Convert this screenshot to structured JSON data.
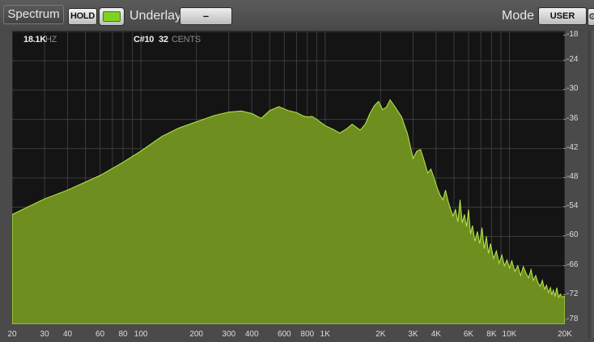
{
  "toolbar": {
    "title": "Spectrum",
    "hold_label": "HOLD",
    "underlay_label": "Underlay",
    "underlay_value": "–",
    "mode_label": "Mode",
    "mode_value": "USER"
  },
  "readout": {
    "freq": "18.1K",
    "freq_unit": "HZ",
    "note": "C#10",
    "cents": "32",
    "cents_unit": "CENTS"
  },
  "colors": {
    "fill": "#6e8f1f",
    "stroke": "#b8e84a",
    "background": "#141414",
    "swatch": "#7ed321"
  },
  "chart_data": {
    "type": "area",
    "x_scale": "log",
    "xlim": [
      20,
      20000
    ],
    "ylim": [
      -78,
      -18
    ],
    "y_ticks": [
      "-18",
      "-24",
      "-30",
      "-36",
      "-42",
      "-48",
      "-54",
      "-60",
      "-66",
      "-72",
      "-78"
    ],
    "x_ticks": [
      {
        "v": 20,
        "label": "20"
      },
      {
        "v": 30,
        "label": "30"
      },
      {
        "v": 40,
        "label": "40"
      },
      {
        "v": 60,
        "label": "60"
      },
      {
        "v": 80,
        "label": "80"
      },
      {
        "v": 100,
        "label": "100"
      },
      {
        "v": 200,
        "label": "200"
      },
      {
        "v": 300,
        "label": "300"
      },
      {
        "v": 400,
        "label": "400"
      },
      {
        "v": 600,
        "label": "600"
      },
      {
        "v": 800,
        "label": "800"
      },
      {
        "v": 1000,
        "label": "1K"
      },
      {
        "v": 2000,
        "label": "2K"
      },
      {
        "v": 3000,
        "label": "3K"
      },
      {
        "v": 4000,
        "label": "4K"
      },
      {
        "v": 6000,
        "label": "6K"
      },
      {
        "v": 8000,
        "label": "8K"
      },
      {
        "v": 10000,
        "label": "10K"
      },
      {
        "v": 20000,
        "label": "20K"
      }
    ],
    "grid_x": [
      20,
      30,
      40,
      50,
      60,
      70,
      80,
      90,
      100,
      200,
      300,
      400,
      500,
      600,
      700,
      800,
      900,
      1000,
      2000,
      3000,
      4000,
      5000,
      6000,
      7000,
      8000,
      9000,
      10000,
      20000
    ],
    "points": [
      [
        20,
        -55.5
      ],
      [
        30,
        -52.3
      ],
      [
        40,
        -50.5
      ],
      [
        60,
        -47.5
      ],
      [
        80,
        -44.8
      ],
      [
        100,
        -42.5
      ],
      [
        130,
        -39.5
      ],
      [
        160,
        -37.8
      ],
      [
        200,
        -36.5
      ],
      [
        250,
        -35.2
      ],
      [
        300,
        -34.5
      ],
      [
        350,
        -34.3
      ],
      [
        400,
        -34.8
      ],
      [
        450,
        -35.8
      ],
      [
        500,
        -34.2
      ],
      [
        560,
        -33.4
      ],
      [
        630,
        -34.2
      ],
      [
        700,
        -34.6
      ],
      [
        760,
        -35.3
      ],
      [
        800,
        -35.5
      ],
      [
        850,
        -35.4
      ],
      [
        900,
        -36.0
      ],
      [
        1000,
        -37.3
      ],
      [
        1100,
        -38.0
      ],
      [
        1200,
        -38.8
      ],
      [
        1300,
        -38.0
      ],
      [
        1400,
        -37.0
      ],
      [
        1550,
        -38.2
      ],
      [
        1650,
        -37.0
      ],
      [
        1750,
        -34.8
      ],
      [
        1850,
        -33.2
      ],
      [
        1950,
        -32.3
      ],
      [
        2050,
        -34.0
      ],
      [
        2150,
        -33.5
      ],
      [
        2250,
        -32.0
      ],
      [
        2400,
        -33.5
      ],
      [
        2600,
        -35.5
      ],
      [
        2800,
        -39.0
      ],
      [
        3000,
        -44.0
      ],
      [
        3150,
        -42.5
      ],
      [
        3300,
        -42.2
      ],
      [
        3450,
        -44.5
      ],
      [
        3600,
        -47.0
      ],
      [
        3750,
        -46.2
      ],
      [
        3900,
        -48.0
      ],
      [
        4050,
        -50.0
      ],
      [
        4200,
        -51.5
      ],
      [
        4350,
        -52.5
      ],
      [
        4500,
        -50.5
      ],
      [
        4650,
        -52.8
      ],
      [
        4800,
        -54.5
      ],
      [
        4950,
        -55.8
      ],
      [
        5100,
        -54.5
      ],
      [
        5250,
        -57.0
      ],
      [
        5400,
        -52.5
      ],
      [
        5550,
        -57.2
      ],
      [
        5700,
        -55.5
      ],
      [
        5850,
        -58.0
      ],
      [
        6000,
        -54.5
      ],
      [
        6150,
        -59.5
      ],
      [
        6300,
        -57.8
      ],
      [
        6500,
        -61.0
      ],
      [
        6700,
        -59.0
      ],
      [
        6900,
        -61.5
      ],
      [
        7100,
        -58.2
      ],
      [
        7300,
        -62.5
      ],
      [
        7500,
        -60.0
      ],
      [
        7700,
        -63.5
      ],
      [
        7900,
        -61.5
      ],
      [
        8200,
        -64.5
      ],
      [
        8500,
        -63.0
      ],
      [
        8800,
        -65.5
      ],
      [
        9100,
        -63.8
      ],
      [
        9400,
        -66.0
      ],
      [
        9700,
        -64.8
      ],
      [
        10000,
        -66.5
      ],
      [
        10300,
        -65.0
      ],
      [
        10700,
        -67.2
      ],
      [
        11100,
        -66.0
      ],
      [
        11500,
        -68.0
      ],
      [
        11900,
        -66.2
      ],
      [
        12300,
        -67.5
      ],
      [
        12700,
        -68.5
      ],
      [
        13100,
        -66.8
      ],
      [
        13500,
        -69.0
      ],
      [
        13900,
        -68.0
      ],
      [
        14300,
        -69.5
      ],
      [
        14700,
        -70.2
      ],
      [
        15100,
        -69.0
      ],
      [
        15500,
        -70.8
      ],
      [
        15900,
        -70.0
      ],
      [
        16300,
        -71.5
      ],
      [
        16700,
        -70.5
      ],
      [
        17000,
        -72.0
      ],
      [
        17300,
        -71.0
      ],
      [
        17700,
        -72.2
      ],
      [
        18100,
        -70.5
      ],
      [
        18500,
        -72.5
      ],
      [
        18900,
        -71.8
      ],
      [
        19300,
        -72.5
      ],
      [
        19700,
        -72.3
      ],
      [
        20000,
        -72.3
      ]
    ]
  }
}
